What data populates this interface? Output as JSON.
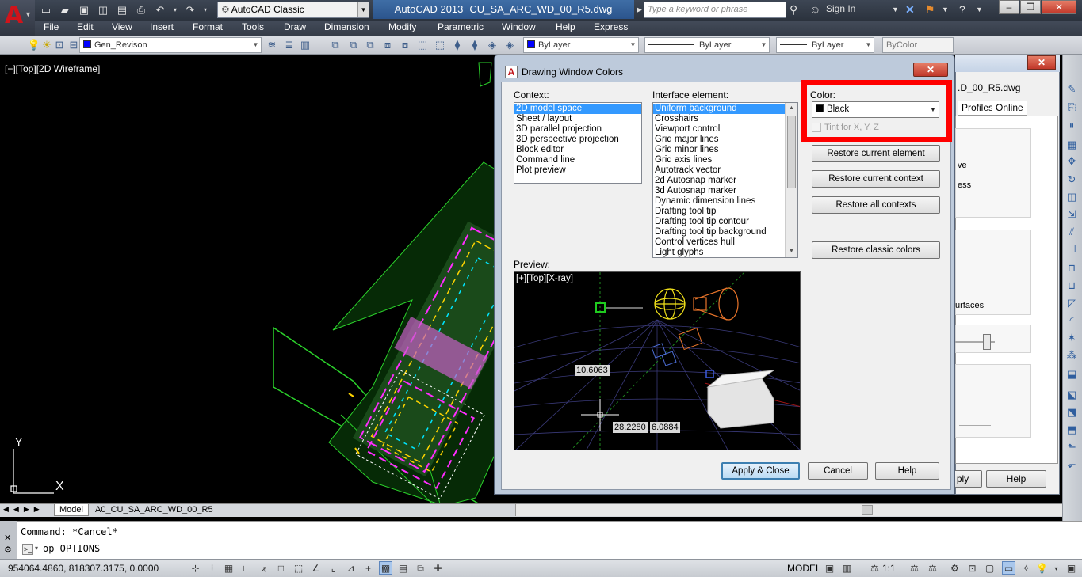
{
  "app": {
    "logo_letter": "A",
    "workspace": "AutoCAD Classic",
    "product": "AutoCAD 2013",
    "document": "CU_SA_ARC_WD_00_R5.dwg",
    "search_placeholder": "Type a keyword or phrase",
    "sign_in": "Sign In"
  },
  "menus": [
    "File",
    "Edit",
    "View",
    "Insert",
    "Format",
    "Tools",
    "Draw",
    "Dimension",
    "Modify",
    "Parametric",
    "Window",
    "Help",
    "Express"
  ],
  "toolbar": {
    "layer": "Gen_Revison",
    "color": "ByLayer",
    "linetype": "ByLayer",
    "lineweight": "ByLayer",
    "plotstyle": "ByColor"
  },
  "viewport": {
    "label": "[−][Top][2D Wireframe]",
    "ucs_y": "Y",
    "ucs_x": "X"
  },
  "layout_tabs": {
    "model": "Model",
    "layout": "A0_CU_SA_ARC_WD_00_R5"
  },
  "command": {
    "history": "Command: *Cancel*",
    "current": "op OPTIONS"
  },
  "status": {
    "coordinates": "954064.4860, 818307.3175, 0.0000",
    "model": "MODEL",
    "scale": "1:1"
  },
  "options_dialog": {
    "file_fragment": ".D_00_R5.dwg",
    "tabs": [
      "Profiles",
      "Online"
    ],
    "text1": "ve",
    "text2": "ess",
    "text3": "urfaces",
    "apply_fragment": "ply",
    "help": "Help"
  },
  "dwc_dialog": {
    "title": "Drawing Window Colors",
    "context_label": "Context:",
    "contexts": [
      "2D model space",
      "Sheet / layout",
      "3D parallel projection",
      "3D perspective projection",
      "Block editor",
      "Command line",
      "Plot preview"
    ],
    "element_label": "Interface element:",
    "elements": [
      "Uniform background",
      "Crosshairs",
      "Viewport control",
      "Grid major lines",
      "Grid minor lines",
      "Grid axis lines",
      "Autotrack vector",
      "2d Autosnap marker",
      "3d Autosnap marker",
      "Dynamic dimension lines",
      "Drafting tool tip",
      "Drafting tool tip contour",
      "Drafting tool tip background",
      "Control vertices hull",
      "Light glyphs"
    ],
    "color_label": "Color:",
    "color_value": "Black",
    "color_swatch": "#000000",
    "tint_label": "Tint for X, Y, Z",
    "restore_element": "Restore current element",
    "restore_context": "Restore current context",
    "restore_all": "Restore all contexts",
    "restore_classic": "Restore classic colors",
    "preview_label": "Preview:",
    "preview_view": "[+][Top][X-ray]",
    "dim1": "10.6063",
    "dim2": "28.2280",
    "dim3": "6.0884",
    "apply_close": "Apply & Close",
    "cancel": "Cancel",
    "help": "Help"
  },
  "colors": {
    "highlight": "#ff0000",
    "selection": "#3399ff",
    "layer_swatch": "#0000ff"
  }
}
